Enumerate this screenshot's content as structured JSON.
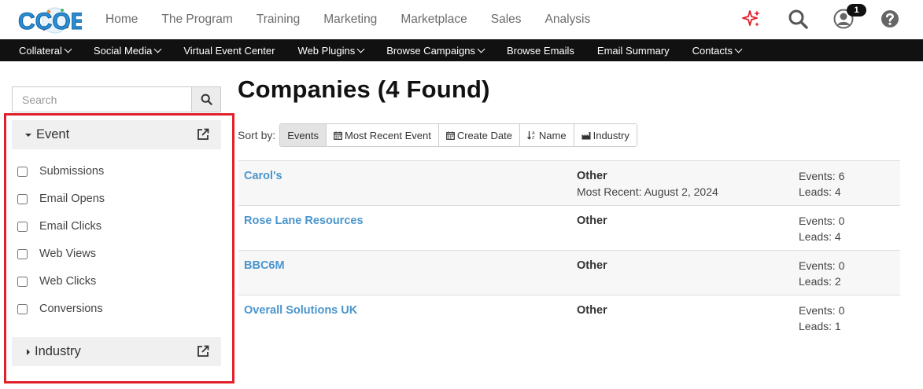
{
  "header": {
    "logo_text": "CCOE",
    "nav": [
      "Home",
      "The Program",
      "Training",
      "Marketing",
      "Marketplace",
      "Sales",
      "Analysis"
    ],
    "notification_count": "1",
    "icons": [
      "sparkle-icon",
      "search-icon",
      "user-icon",
      "help-icon"
    ]
  },
  "subnav": [
    {
      "label": "Collateral",
      "dropdown": true
    },
    {
      "label": "Social Media",
      "dropdown": true
    },
    {
      "label": "Virtual Event Center",
      "dropdown": false
    },
    {
      "label": "Web Plugins",
      "dropdown": true
    },
    {
      "label": "Browse Campaigns",
      "dropdown": true
    },
    {
      "label": "Browse Emails",
      "dropdown": false
    },
    {
      "label": "Email Summary",
      "dropdown": false
    },
    {
      "label": "Contacts",
      "dropdown": true
    }
  ],
  "sidebar": {
    "search_placeholder": "Search",
    "event_facet": {
      "title": "Event",
      "options": [
        "Submissions",
        "Email Opens",
        "Email Clicks",
        "Web Views",
        "Web Clicks",
        "Conversions"
      ]
    },
    "industry_facet": {
      "title": "Industry"
    }
  },
  "main": {
    "title": "Companies (4 Found)",
    "sort_label": "Sort by:",
    "sort_options": [
      "Events",
      "Most Recent Event",
      "Create Date",
      "Name",
      "Industry"
    ],
    "active_sort": "Events",
    "companies": [
      {
        "name": "Carol's",
        "industry": "Other",
        "recent": "Most Recent: August 2, 2024",
        "events": "Events: 6",
        "leads": "Leads: 4"
      },
      {
        "name": "Rose Lane Resources",
        "industry": "Other",
        "recent": "",
        "events": "Events: 0",
        "leads": "Leads: 4"
      },
      {
        "name": "BBC6M",
        "industry": "Other",
        "recent": "",
        "events": "Events: 0",
        "leads": "Leads: 2"
      },
      {
        "name": "Overall Solutions UK",
        "industry": "Other",
        "recent": "",
        "events": "Events: 0",
        "leads": "Leads: 1"
      }
    ]
  },
  "colors": {
    "accent_link": "#4a95cd",
    "subnav_bg": "#111111",
    "highlight_border": "#e0202a",
    "logo_blue": "#2b8fd6",
    "sparkle_red": "#e0202a"
  }
}
